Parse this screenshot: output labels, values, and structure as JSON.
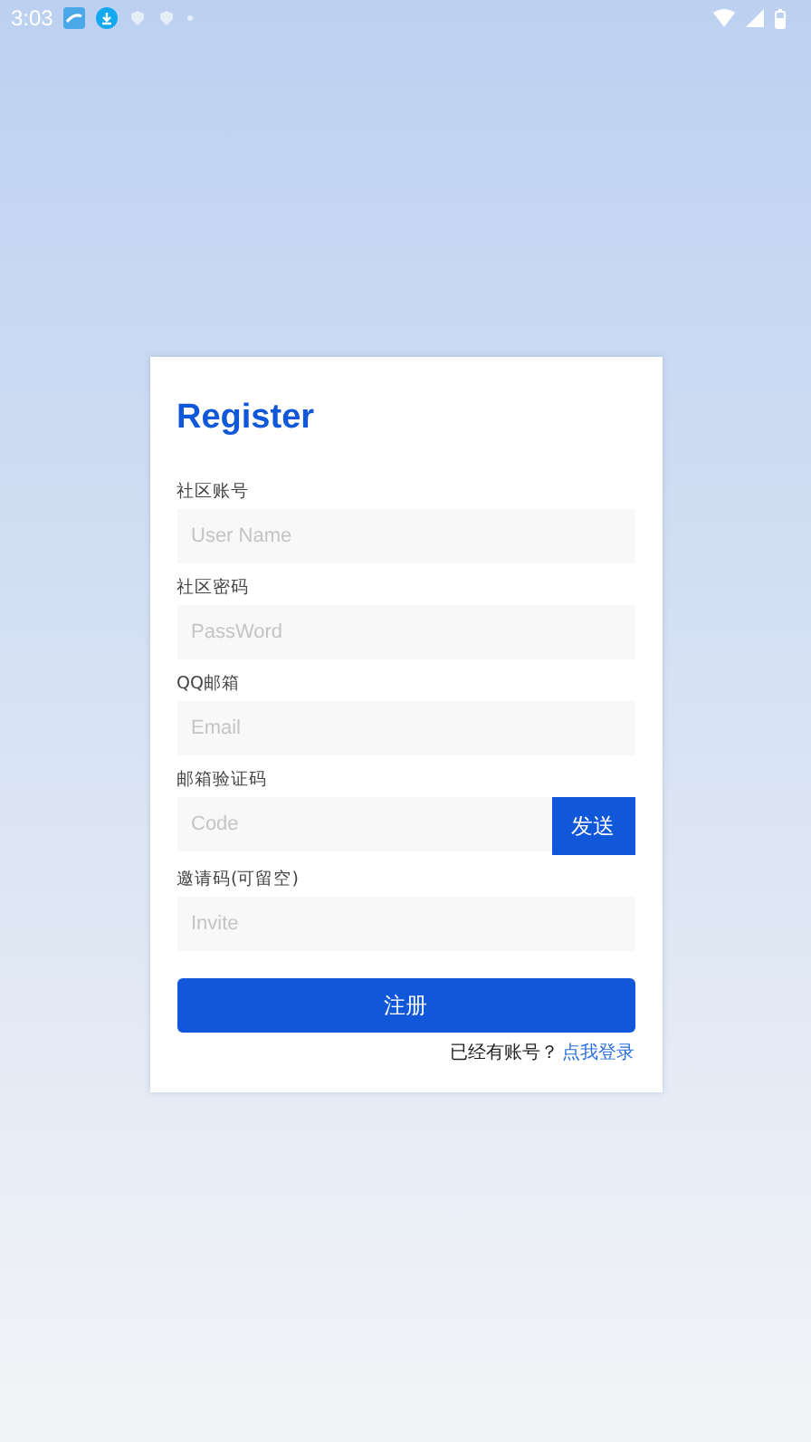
{
  "status_bar": {
    "time": "3:03"
  },
  "form": {
    "title": "Register",
    "fields": [
      {
        "kind": "text",
        "label": "社区账号",
        "placeholder": "User Name"
      },
      {
        "kind": "text",
        "label": "社区密码",
        "placeholder": "PassWord"
      },
      {
        "kind": "text",
        "label": "QQ邮箱",
        "placeholder": "Email"
      },
      {
        "kind": "code",
        "label": "邮箱验证码",
        "placeholder": "Code",
        "button": "发送"
      },
      {
        "kind": "text",
        "label": "邀请码(可留空)",
        "placeholder": "Invite"
      }
    ],
    "submit": "注册",
    "footer": {
      "prompt": "已经有账号？",
      "link": "点我登录"
    }
  }
}
